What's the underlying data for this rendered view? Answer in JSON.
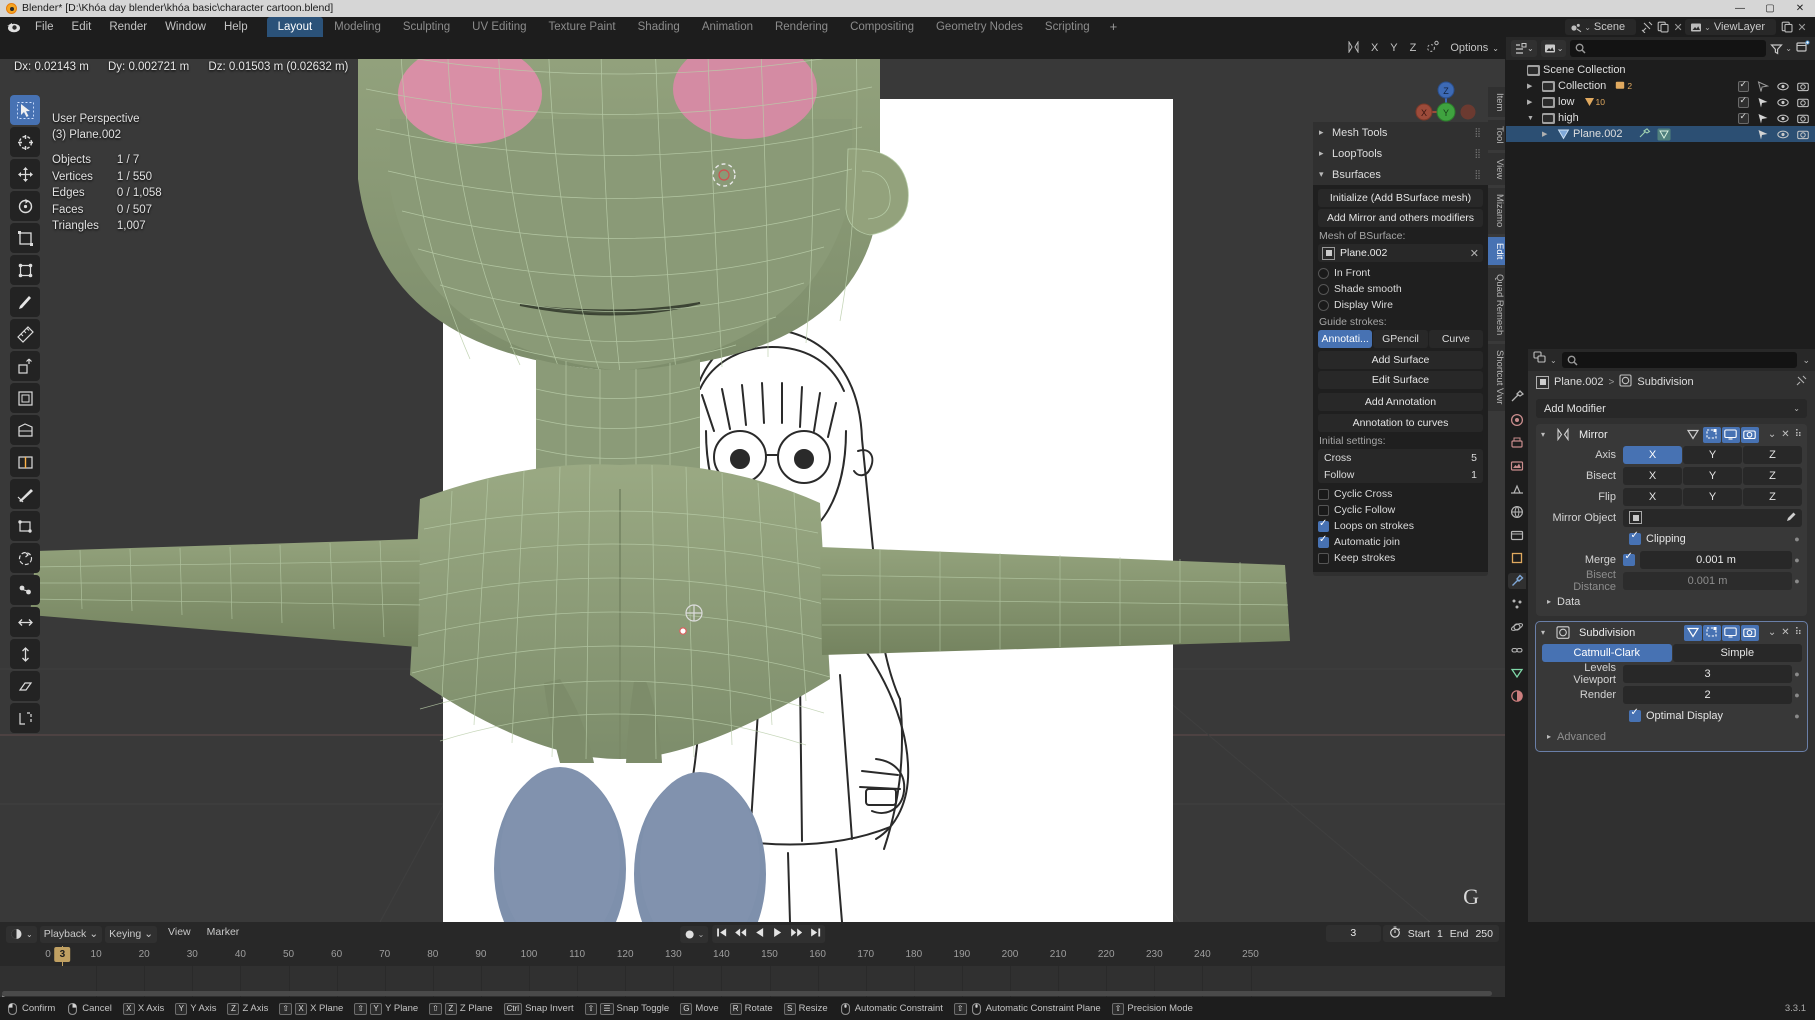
{
  "window": {
    "title": "Blender* [D:\\Khóa day blender\\khóa basic\\character cartoon.blend]",
    "minimize": "—",
    "maximize": "▢",
    "close": "✕"
  },
  "topbar": {
    "menus": [
      "File",
      "Edit",
      "Render",
      "Window",
      "Help"
    ],
    "workspace_tabs": [
      {
        "label": "Layout",
        "active": true
      },
      {
        "label": "Modeling",
        "active": false
      },
      {
        "label": "Sculpting",
        "active": false
      },
      {
        "label": "UV Editing",
        "active": false
      },
      {
        "label": "Texture Paint",
        "active": false
      },
      {
        "label": "Shading",
        "active": false
      },
      {
        "label": "Animation",
        "active": false
      },
      {
        "label": "Rendering",
        "active": false
      },
      {
        "label": "Compositing",
        "active": false
      },
      {
        "label": "Geometry Nodes",
        "active": false
      },
      {
        "label": "Scripting",
        "active": false
      }
    ],
    "add_workspace": "+",
    "scene_name": "Scene",
    "viewlayer_name": "ViewLayer",
    "scene_icon": "scene-icon",
    "viewlayer_icon": "viewlayer-icon",
    "pin_icon": "pin-icon",
    "copy_icon": "duplicate-icon",
    "close_x": "✕"
  },
  "viewport": {
    "transform_info": {
      "dx": "Dx: 0.02143 m",
      "dy": "Dy: 0.002721 m",
      "dz": "Dz: 0.01503 m (0.02632 m)"
    },
    "header_right": {
      "axis_labels": [
        "X",
        "Y",
        "Z"
      ],
      "options_label": "Options",
      "mirror_icon": "mirror-icon",
      "proportional_icon": "proportional-editing-icon",
      "chevron": "⌄"
    },
    "stats": {
      "view_name": "User Perspective",
      "object_name": "(3) Plane.002",
      "rows": [
        {
          "key": "Objects",
          "value": "1 / 7"
        },
        {
          "key": "Vertices",
          "value": "1 / 550"
        },
        {
          "key": "Edges",
          "value": "0 / 1,058"
        },
        {
          "key": "Faces",
          "value": "0 / 507"
        },
        {
          "key": "Triangles",
          "value": "1,007"
        }
      ]
    },
    "gizmo": {
      "x_label": "X",
      "y_label": "Y",
      "z_label": "Z"
    },
    "gizmo_tools": [
      "zoom-icon",
      "hand-pan-icon",
      "camera-view-icon",
      "perspective-toggle-icon"
    ],
    "modal_key_hint": "G",
    "tools": [
      {
        "name": "tweak-select-tool",
        "active": true
      },
      {
        "name": "cursor-tool",
        "active": false
      },
      {
        "name": "move-tool",
        "active": false
      },
      {
        "name": "rotate-tool",
        "active": false
      },
      {
        "name": "scale-tool",
        "active": false
      },
      {
        "name": "transform-tool",
        "active": false
      },
      {
        "name": "annotate-tool",
        "active": false
      },
      {
        "name": "measure-tool",
        "active": false
      },
      {
        "name": "extrude-region-tool",
        "active": false
      },
      {
        "name": "inset-faces-tool",
        "active": false
      },
      {
        "name": "bevel-tool",
        "active": false
      },
      {
        "name": "loop-cut-tool",
        "active": false
      },
      {
        "name": "knife-tool",
        "active": false
      },
      {
        "name": "poly-build-tool",
        "active": false
      },
      {
        "name": "spin-tool",
        "active": false
      },
      {
        "name": "smooth-tool",
        "active": false
      },
      {
        "name": "edge-slide-tool",
        "active": false
      },
      {
        "name": "shrink-fatten-tool",
        "active": false
      },
      {
        "name": "shear-tool",
        "active": false
      },
      {
        "name": "rip-region-tool",
        "active": false
      }
    ],
    "n_panel_tabs": [
      {
        "label": "Item",
        "active": false
      },
      {
        "label": "Tool",
        "active": false
      },
      {
        "label": "View",
        "active": false
      },
      {
        "label": "Mizamo",
        "active": false
      },
      {
        "label": "Edit",
        "active": true
      },
      {
        "label": "Quad Remesh",
        "active": false
      },
      {
        "label": "Shortcut Vwr",
        "active": false
      }
    ]
  },
  "bsurfaces": {
    "sections": [
      {
        "label": "Mesh Tools",
        "open": false
      },
      {
        "label": "LoopTools",
        "open": false
      },
      {
        "label": "Bsurfaces",
        "open": true
      }
    ],
    "initialize_button": "Initialize (Add BSurface mesh)",
    "add_mirror_button": "Add Mirror and others modifiers",
    "mesh_of_bsurface_label": "Mesh of BSurface:",
    "mesh_value": "Plane.002",
    "mesh_clear": "✕",
    "options": [
      {
        "label": "In Front",
        "checked": false
      },
      {
        "label": "Shade smooth",
        "checked": false
      },
      {
        "label": "Display Wire",
        "checked": false
      }
    ],
    "guide_strokes_label": "Guide strokes:",
    "guide_modes": [
      {
        "label": "Annotati...",
        "active": true
      },
      {
        "label": "GPencil",
        "active": false
      },
      {
        "label": "Curve",
        "active": false
      }
    ],
    "add_surface_button": "Add Surface",
    "edit_surface_button": "Edit Surface",
    "add_annotation_button": "Add Annotation",
    "annotation_to_curves_button": "Annotation to curves",
    "initial_settings_label": "Initial settings:",
    "cross_label": "Cross",
    "cross_value": "5",
    "follow_label": "Follow",
    "follow_value": "1",
    "checks": [
      {
        "label": "Cyclic Cross",
        "checked": false
      },
      {
        "label": "Cyclic Follow",
        "checked": false
      },
      {
        "label": "Loops on strokes",
        "checked": true
      },
      {
        "label": "Automatic join",
        "checked": true
      },
      {
        "label": "Keep strokes",
        "checked": false
      }
    ]
  },
  "outliner": {
    "display_mode_icon": "view-layer-icon",
    "filter_icon": "filter-icon",
    "new_collection_icon": "new-collection-icon",
    "search_placeholder": "",
    "search_icon": "search-icon",
    "rows": [
      {
        "name": "Scene Collection",
        "indent": 0,
        "twisty": "",
        "icon": "collection-icon",
        "badge": "",
        "selected": false,
        "show_controls": false
      },
      {
        "name": "Collection",
        "indent": 1,
        "twisty": "▶",
        "icon": "collection-icon",
        "badge": "2",
        "badge_icon": "object-icon",
        "selected": false,
        "show_controls": true,
        "checkbox": true,
        "arrow_filled": false
      },
      {
        "name": "low",
        "indent": 1,
        "twisty": "▶",
        "icon": "collection-icon",
        "badge": "10",
        "badge_icon": "mesh-icon",
        "selected": false,
        "show_controls": true,
        "checkbox": true,
        "arrow_filled": true
      },
      {
        "name": "high",
        "indent": 1,
        "twisty": "▼",
        "icon": "collection-icon",
        "badge": "",
        "selected": false,
        "show_controls": true,
        "checkbox": true,
        "arrow_filled": true
      },
      {
        "name": "Plane.002",
        "indent": 2,
        "twisty": "▶",
        "icon": "mesh-data-icon",
        "badge": "",
        "selected": true,
        "show_controls": true,
        "checkbox": false,
        "arrow_filled": true
      }
    ],
    "row_control_icons": [
      "visibility-arrow-icon",
      "eye-icon",
      "camera-icon"
    ]
  },
  "properties": {
    "tabs": [
      {
        "name": "tool-tab",
        "glyph": "🛠",
        "active": false
      },
      {
        "name": "render-tab",
        "glyph": "◉",
        "active": false
      },
      {
        "name": "output-tab",
        "glyph": "🖨",
        "active": false
      },
      {
        "name": "view-layer-tab",
        "glyph": "▤",
        "active": false
      },
      {
        "name": "scene-tab",
        "glyph": "▵",
        "active": false
      },
      {
        "name": "world-tab",
        "glyph": "●",
        "active": false
      },
      {
        "name": "collection-tab",
        "glyph": "▣",
        "active": false
      },
      {
        "name": "object-tab",
        "glyph": "▢",
        "active": false
      },
      {
        "name": "modifier-tab",
        "glyph": "🔧",
        "active": true
      },
      {
        "name": "particles-tab",
        "glyph": "✦",
        "active": false
      },
      {
        "name": "physics-tab",
        "glyph": "↻",
        "active": false
      },
      {
        "name": "constraints-tab",
        "glyph": "⛓",
        "active": false
      },
      {
        "name": "data-tab",
        "glyph": "▽",
        "active": false
      },
      {
        "name": "material-tab",
        "glyph": "◓",
        "active": false
      }
    ],
    "search_placeholder": "",
    "breadcrumb": {
      "object": "Plane.002",
      "separator": ">",
      "current": "Subdivision"
    },
    "add_modifier_label": "Add Modifier",
    "modifiers": [
      {
        "name": "Mirror",
        "icon": "mirror-modifier-icon",
        "expanded": true,
        "toggles": [
          {
            "name": "edit-mode-display-toggle",
            "on": false,
            "glyph": "▽"
          },
          {
            "name": "on-cage-toggle",
            "on": true,
            "glyph": "⬚"
          },
          {
            "name": "realtime-display-toggle",
            "on": true,
            "glyph": "▭"
          },
          {
            "name": "render-display-toggle",
            "on": true,
            "glyph": "▣"
          }
        ],
        "rows": [
          {
            "type": "segs",
            "label": "Axis",
            "options": [
              "X",
              "Y",
              "Z"
            ],
            "active_index": 0
          },
          {
            "type": "segs",
            "label": "Bisect",
            "options": [
              "X",
              "Y",
              "Z"
            ],
            "active_index": -1
          },
          {
            "type": "segs",
            "label": "Flip",
            "options": [
              "X",
              "Y",
              "Z"
            ],
            "active_index": -1
          },
          {
            "type": "object",
            "label": "Mirror Object",
            "value": ""
          },
          {
            "type": "check",
            "label": "",
            "check_label": "Clipping",
            "checked": true
          },
          {
            "type": "check_field",
            "label": "Merge",
            "checked": true,
            "value": "0.001 m"
          },
          {
            "type": "field_dim",
            "label": "Bisect Distance",
            "value": "0.001 m"
          },
          {
            "type": "sub",
            "label": "Data",
            "open": false
          }
        ]
      },
      {
        "name": "Subdivision",
        "icon": "subdivision-modifier-icon",
        "expanded": true,
        "active": true,
        "toggles": [
          {
            "name": "edit-mode-display-toggle",
            "on": true,
            "glyph": "▽"
          },
          {
            "name": "on-cage-toggle",
            "on": true,
            "glyph": "⬚"
          },
          {
            "name": "realtime-display-toggle",
            "on": true,
            "glyph": "▭"
          },
          {
            "name": "render-display-toggle",
            "on": true,
            "glyph": "▣"
          }
        ],
        "rows": [
          {
            "type": "segs_full",
            "options": [
              "Catmull-Clark",
              "Simple"
            ],
            "active_index": 0
          },
          {
            "type": "num",
            "label": "Levels Viewport",
            "value": "3"
          },
          {
            "type": "num",
            "label": "Render",
            "value": "2"
          },
          {
            "type": "check",
            "label": "",
            "check_label": "Optimal Display",
            "checked": true
          },
          {
            "type": "sub",
            "label": "Advanced",
            "open": false
          }
        ]
      }
    ]
  },
  "timeline": {
    "editor_icon": "timeline-editor-icon",
    "menus": [
      {
        "label": "Playback",
        "dropdown": true
      },
      {
        "label": "Keying",
        "dropdown": true
      },
      {
        "label": "View",
        "dropdown": false
      },
      {
        "label": "Marker",
        "dropdown": false
      }
    ],
    "auto_key_icon": "record-icon",
    "playback_buttons": [
      "jump-to-start-icon",
      "jump-prev-keyframe-icon",
      "play-reverse-icon",
      "play-icon",
      "jump-next-keyframe-icon",
      "jump-to-end-icon"
    ],
    "current_frame": "3",
    "stopwatch_icon": "use-preview-range-icon",
    "start_label": "Start",
    "start_value": "1",
    "end_label": "End",
    "end_value": "250",
    "ticks": [
      0,
      10,
      20,
      30,
      40,
      50,
      60,
      70,
      80,
      90,
      100,
      110,
      120,
      130,
      140,
      150,
      160,
      170,
      180,
      190,
      200,
      210,
      220,
      230,
      240,
      250
    ],
    "playhead_frame": 3,
    "playhead_label": "3",
    "playhead_color": "#c0a062"
  },
  "statusbar": {
    "items": [
      {
        "keys": [
          "mouse-left"
        ],
        "label": "Confirm"
      },
      {
        "keys": [
          "mouse-right"
        ],
        "label": "Cancel"
      },
      {
        "keys": [
          "X"
        ],
        "label": "X Axis"
      },
      {
        "keys": [
          "Y"
        ],
        "label": "Y Axis"
      },
      {
        "keys": [
          "Z"
        ],
        "label": "Z Axis"
      },
      {
        "keys": [
          "⇧",
          "X"
        ],
        "label": "X Plane"
      },
      {
        "keys": [
          "⇧",
          "Y"
        ],
        "label": "Y Plane"
      },
      {
        "keys": [
          "⇧",
          "Z"
        ],
        "label": "Z Plane"
      },
      {
        "keys": [
          "Ctrl"
        ],
        "label": "Snap Invert"
      },
      {
        "keys": [
          "⇧",
          "☰"
        ],
        "label": "Snap Toggle"
      },
      {
        "keys": [
          "G"
        ],
        "label": "Move"
      },
      {
        "keys": [
          "R"
        ],
        "label": "Rotate"
      },
      {
        "keys": [
          "S"
        ],
        "label": "Resize"
      },
      {
        "keys": [
          "mouse-mid"
        ],
        "label": "Automatic Constraint"
      },
      {
        "keys": [
          "⇧",
          "mouse-mid"
        ],
        "label": "Automatic Constraint Plane"
      },
      {
        "keys": [
          "⇧"
        ],
        "label": "Precision Mode"
      }
    ],
    "version": "3.3.1"
  },
  "colors": {
    "accent_blue": "#4772b3",
    "playhead": "#c0a062",
    "mesh_green": "#8d9c78",
    "pants_blue": "#7a8ba8",
    "eye_pink": "#d98fa6",
    "viewport_bg": "#393939",
    "panel_bg": "#303030",
    "field_bg": "#282828"
  }
}
